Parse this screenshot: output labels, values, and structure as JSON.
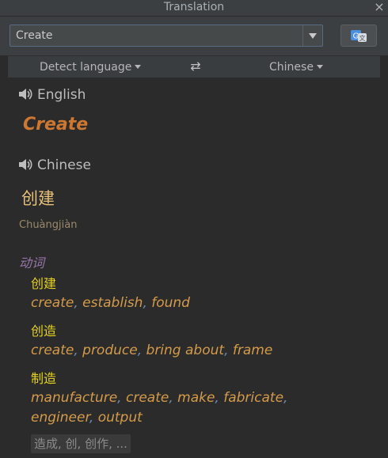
{
  "window": {
    "title": "Translation",
    "close_label": "×"
  },
  "input": {
    "value": "Create"
  },
  "languages": {
    "source": "Detect language",
    "target": "Chinese",
    "swap_label": "⇄"
  },
  "source": {
    "language": "English",
    "word": "Create"
  },
  "target": {
    "language": "Chinese",
    "word": "创建",
    "phonetic": "Chuàngjiàn",
    "part_of_speech": "动词",
    "entries": [
      {
        "word": "创建",
        "meanings": [
          "create",
          "establish",
          "found"
        ]
      },
      {
        "word": "创造",
        "meanings": [
          "create",
          "produce",
          "bring about",
          "frame"
        ]
      },
      {
        "word": "制造",
        "meanings": [
          "manufacture",
          "create",
          "make",
          "fabricate",
          "engineer",
          "output"
        ]
      }
    ],
    "more": "造成, 创, 创作, ..."
  },
  "colors": {
    "source_word": "#cc7832",
    "target_word": "#e6c07b",
    "pos": "#9876aa",
    "entry_word": "#e6d21f",
    "meaning": "#d49b4a",
    "separator": "#6a8ab0"
  },
  "icons": {
    "speaker": "speaker-icon",
    "translate": "translate-icon",
    "swap": "swap-icon",
    "close": "close-icon",
    "dropdown": "chevron-down-icon"
  }
}
